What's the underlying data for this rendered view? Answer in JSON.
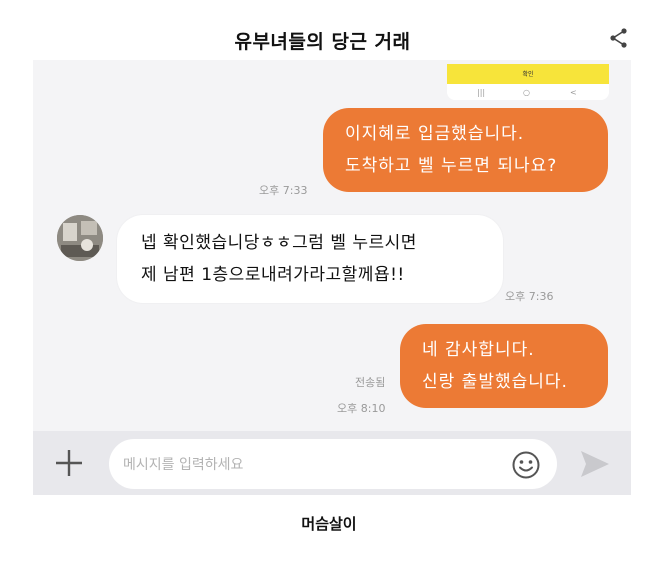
{
  "header": {
    "title": "유부녀들의 당근 거래"
  },
  "icons": {
    "share": "share-icon",
    "plus": "plus-icon",
    "emoji": "smiley-icon",
    "send": "send-icon"
  },
  "phone_strip": {
    "label": "확인"
  },
  "messages": [
    {
      "side": "out",
      "lines": [
        "이지혜로 입금했습니다.",
        "도착하고 벨 누르면 되나요?"
      ],
      "time": "오후 7:33"
    },
    {
      "side": "in",
      "lines": [
        "넵 확인했습니당ㅎㅎ그럼 벨 누르시면",
        "제 남편 1층으로내려가라고할께욥!!"
      ],
      "time": "오후 7:36"
    },
    {
      "side": "out",
      "lines": [
        "네 감사합니다.",
        "신랑 출발했습니다."
      ],
      "status": "전송됨",
      "time": "오후 8:10"
    }
  ],
  "input": {
    "placeholder": "메시지를 입력하세요"
  },
  "caption": "머슴살이",
  "colors": {
    "outgoing_bubble": "#ec7a35",
    "incoming_bubble": "#ffffff",
    "chat_background": "#f4f4f6",
    "phone_yellow": "#f7e43a"
  }
}
